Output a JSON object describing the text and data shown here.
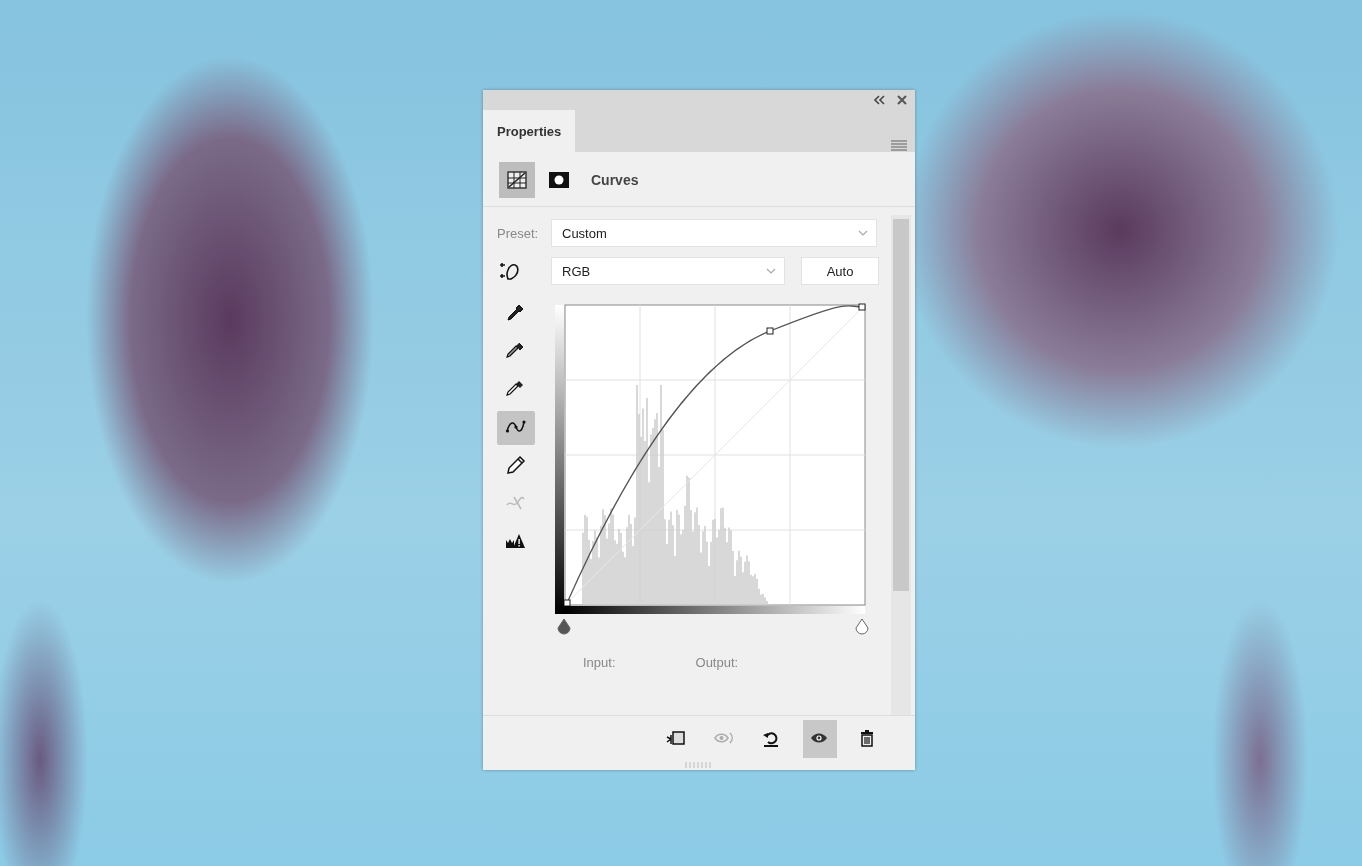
{
  "panel": {
    "tab": {
      "label": "Properties",
      "selected": true
    },
    "header": {
      "modes": [
        {
          "kind": "adjustment",
          "selected": true
        },
        {
          "kind": "mask",
          "selected": false
        }
      ],
      "title": "Curves"
    },
    "preset": {
      "label": "Preset:",
      "value": "Custom"
    },
    "channel": {
      "value": "RGB"
    },
    "auto_button": "Auto",
    "tools": [
      {
        "kind": "black-point",
        "selected": false,
        "disabled": false
      },
      {
        "kind": "gray-point",
        "selected": false,
        "disabled": false
      },
      {
        "kind": "white-point",
        "selected": false,
        "disabled": false
      },
      {
        "kind": "curve-points",
        "selected": true,
        "disabled": false
      },
      {
        "kind": "pencil",
        "selected": false,
        "disabled": false
      },
      {
        "kind": "smooth",
        "selected": false,
        "disabled": true
      },
      {
        "kind": "clipping",
        "selected": false,
        "disabled": false
      }
    ],
    "input_sliders": [
      {
        "kind": "shadow",
        "level": 0
      },
      {
        "kind": "highlight",
        "level": 1
      }
    ],
    "input_label": "Input:",
    "output_label": "Output:",
    "footer_buttons": [
      {
        "kind": "clip",
        "selected": false,
        "disabled": false
      },
      {
        "kind": "view-previous",
        "selected": false,
        "disabled": true
      },
      {
        "kind": "reset",
        "selected": false,
        "disabled": false
      },
      {
        "kind": "visibility",
        "selected": true,
        "disabled": false
      },
      {
        "kind": "delete",
        "selected": false,
        "disabled": false
      }
    ]
  }
}
